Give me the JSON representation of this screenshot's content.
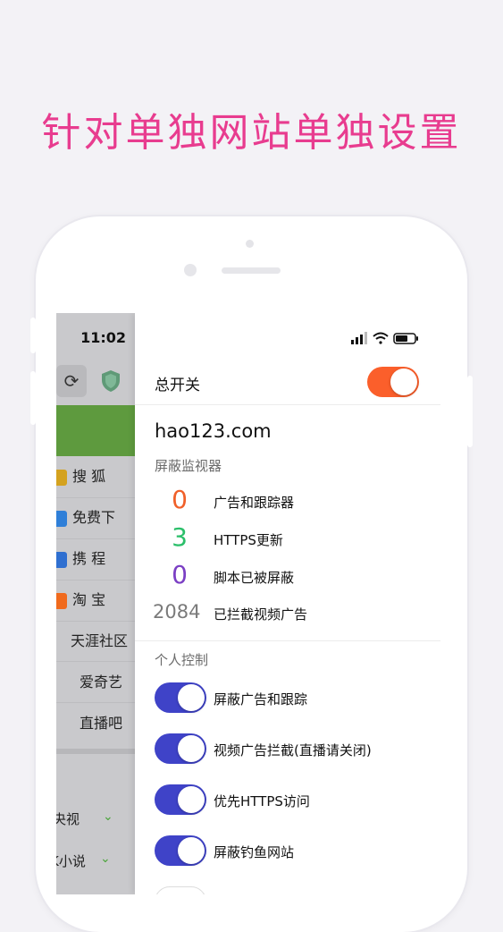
{
  "headline": "针对单独网站单独设置",
  "browser": {
    "time": "11:02",
    "links": [
      {
        "label": "搜 狐",
        "icon_color": "#d4a21f"
      },
      {
        "label": "免费下",
        "icon_color": "#2f7fd8"
      },
      {
        "label": "携 程",
        "icon_color": "#2f6fd0"
      },
      {
        "label": "淘 宝",
        "icon_color": "#f06a1d"
      },
      {
        "label": "天涯社区",
        "icon_color": ""
      },
      {
        "label": "爱奇艺",
        "icon_color": ""
      },
      {
        "label": "直播吧",
        "icon_color": ""
      }
    ],
    "categories": [
      {
        "label": "央视",
        "chevron": "✓"
      },
      {
        "label": "K小说",
        "chevron": "✓"
      }
    ]
  },
  "panel": {
    "master_label": "总开关",
    "master_on": true,
    "site": "hao123.com",
    "monitor_title": "屏蔽监视器",
    "stats": [
      {
        "value": "0",
        "label": "广告和跟踪器",
        "color": "#f0602a"
      },
      {
        "value": "3",
        "label": "HTTPS更新",
        "color": "#2bbf6a"
      },
      {
        "value": "0",
        "label": "脚本已被屏蔽",
        "color": "#7b3fc4"
      },
      {
        "value": "2084",
        "label": "已拦截视频广告",
        "color": "#7a7a7a"
      }
    ],
    "control_title": "个人控制",
    "controls": [
      {
        "label": "屏蔽广告和跟踪",
        "on": true
      },
      {
        "label": "视频广告拦截(直播请关闭)",
        "on": true
      },
      {
        "label": "优先HTTPS访问",
        "on": true
      },
      {
        "label": "屏蔽钓鱼网站",
        "on": true
      }
    ],
    "colors": {
      "orange": "#fb5f2b",
      "toggle_blue": "#3f43c8"
    }
  }
}
